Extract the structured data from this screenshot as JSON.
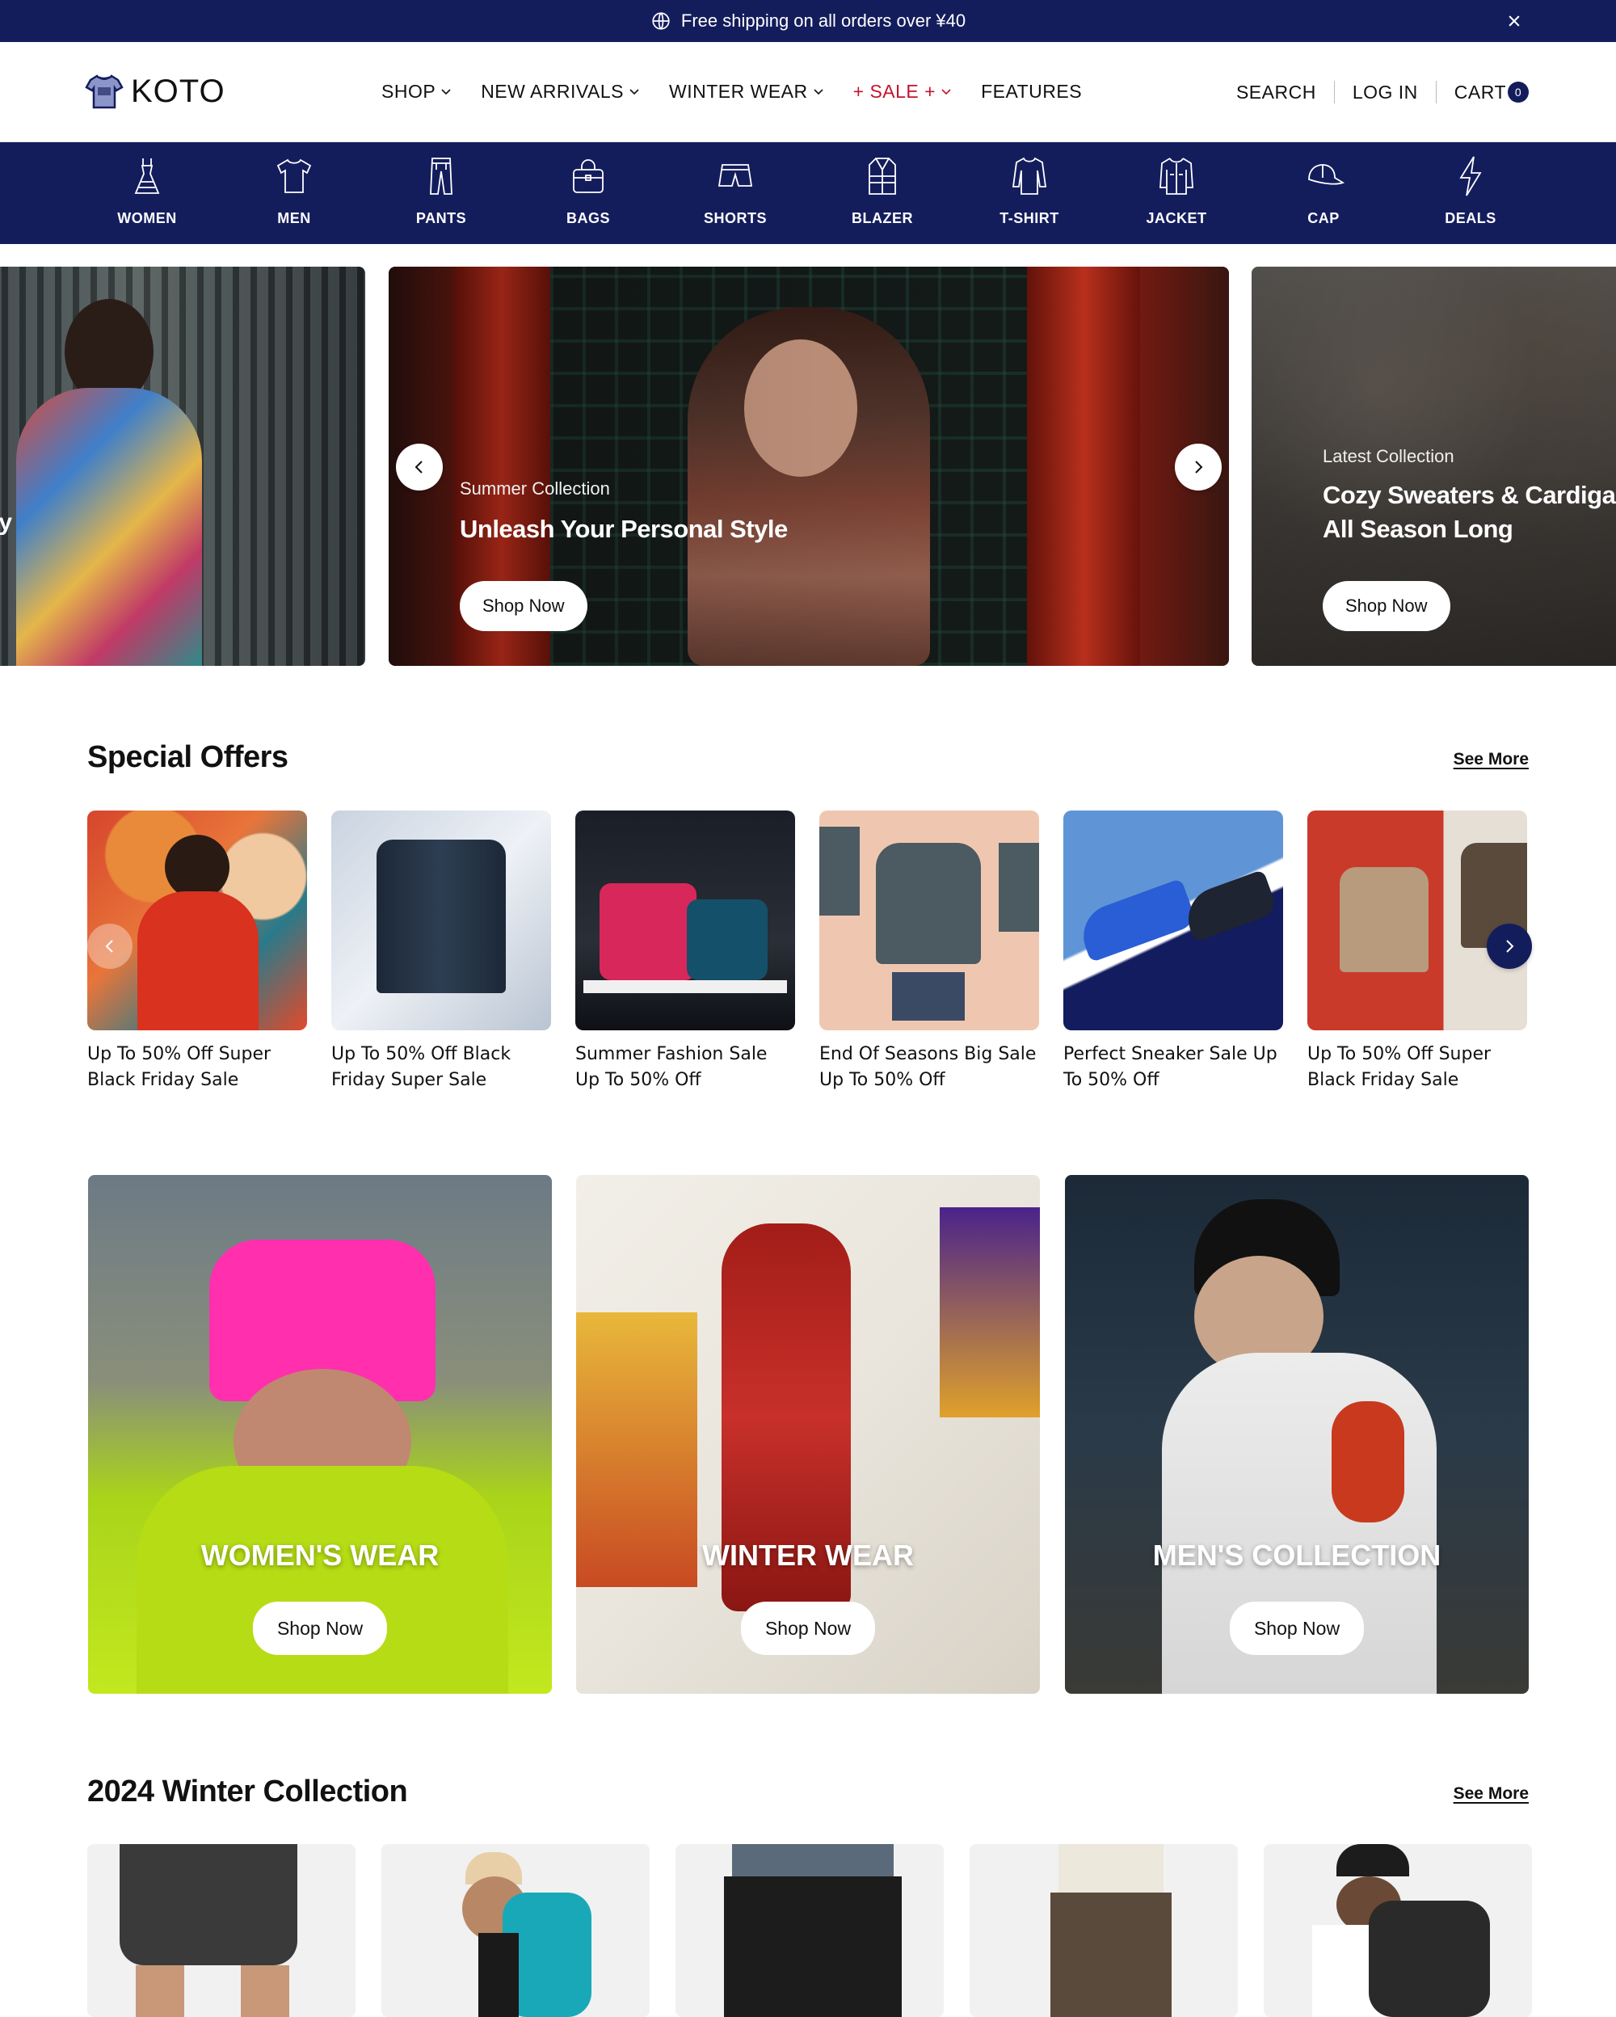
{
  "announcement": {
    "text": "Free shipping on all orders over ¥40"
  },
  "header": {
    "logo_text": "KOTO",
    "nav": [
      {
        "label": "SHOP"
      },
      {
        "label": "NEW ARRIVALS"
      },
      {
        "label": "WINTER WEAR"
      },
      {
        "label": "+ SALE +"
      },
      {
        "label": "FEATURES"
      }
    ],
    "search_label": "SEARCH",
    "login_label": "LOG IN",
    "cart_label": "CART",
    "cart_count": "0"
  },
  "categories": [
    {
      "label": "WOMEN",
      "icon": "dress-icon"
    },
    {
      "label": "MEN",
      "icon": "tshirt-icon"
    },
    {
      "label": "PANTS",
      "icon": "pants-icon"
    },
    {
      "label": "BAGS",
      "icon": "bag-icon"
    },
    {
      "label": "SHORTS",
      "icon": "shorts-icon"
    },
    {
      "label": "BLAZER",
      "icon": "blazer-icon"
    },
    {
      "label": "T-SHIRT",
      "icon": "longsleeve-icon"
    },
    {
      "label": "JACKET",
      "icon": "jacket-icon"
    },
    {
      "label": "CAP",
      "icon": "cap-icon"
    },
    {
      "label": "DEALS",
      "icon": "lightning-icon"
    }
  ],
  "hero": {
    "left_partial_text": "ity",
    "center": {
      "subtitle": "Summer Collection",
      "title": "Unleash Your Personal Style",
      "button": "Shop Now"
    },
    "right": {
      "subtitle": "Latest Collection",
      "title_line1": "Cozy Sweaters & Cardigan",
      "title_line2": "All Season Long",
      "button": "Shop Now"
    }
  },
  "special_offers": {
    "title": "Special Offers",
    "see_more": "See More",
    "items": [
      {
        "line1": "Up To 50% Off Super",
        "line2": "Black Friday Sale"
      },
      {
        "line1": "Up To 50% Off Black",
        "line2": "Friday Super Sale"
      },
      {
        "line1": "Summer Fashion Sale",
        "line2": "Up To 50% Off"
      },
      {
        "line1": "End Of Seasons Big Sale",
        "line2": "Up To 50% Off"
      },
      {
        "line1": "Perfect Sneaker Sale Up",
        "line2": "To 50% Off"
      },
      {
        "line1": "Up To 50% Off Super",
        "line2": "Black Friday Sale"
      }
    ]
  },
  "banners": [
    {
      "title": "WOMEN'S WEAR",
      "button": "Shop Now"
    },
    {
      "title": "WINTER WEAR",
      "button": "Shop Now"
    },
    {
      "title": "MEN'S COLLECTION",
      "button": "Shop Now"
    }
  ],
  "winter_collection": {
    "title": "2024 Winter Collection",
    "see_more": "See More"
  },
  "colors": {
    "brand_navy": "#141d5c",
    "sale_red": "#c0152f"
  }
}
